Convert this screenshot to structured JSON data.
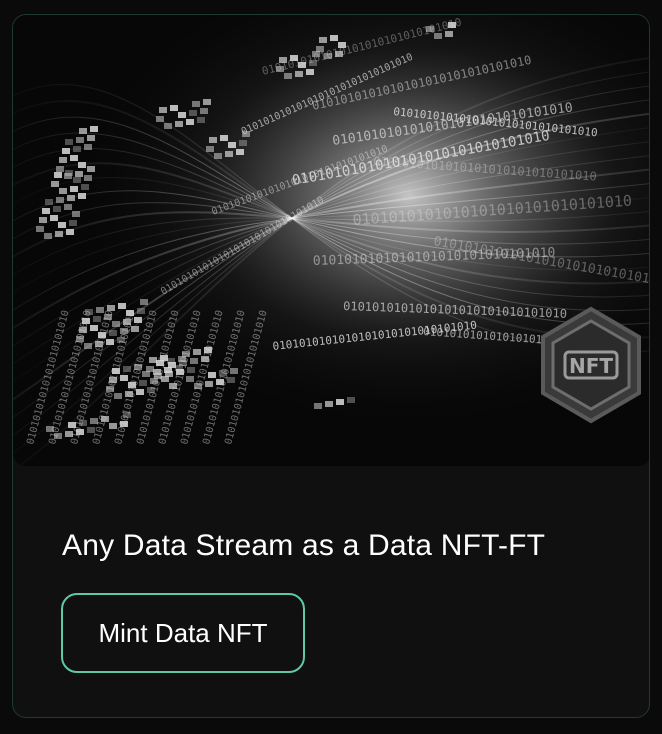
{
  "card": {
    "hero_image_alt_icon": "data-stream-binary-artwork",
    "badge_text": "NFT",
    "title": "Any Data Stream as a Data NFT-FT",
    "mint_button_label": "Mint Data NFT"
  },
  "colors": {
    "page_background": "#0a0a0a",
    "card_background": "#101010",
    "card_border": "#1f3a33",
    "button_border": "#5fc9a3",
    "text": "#ffffff"
  }
}
